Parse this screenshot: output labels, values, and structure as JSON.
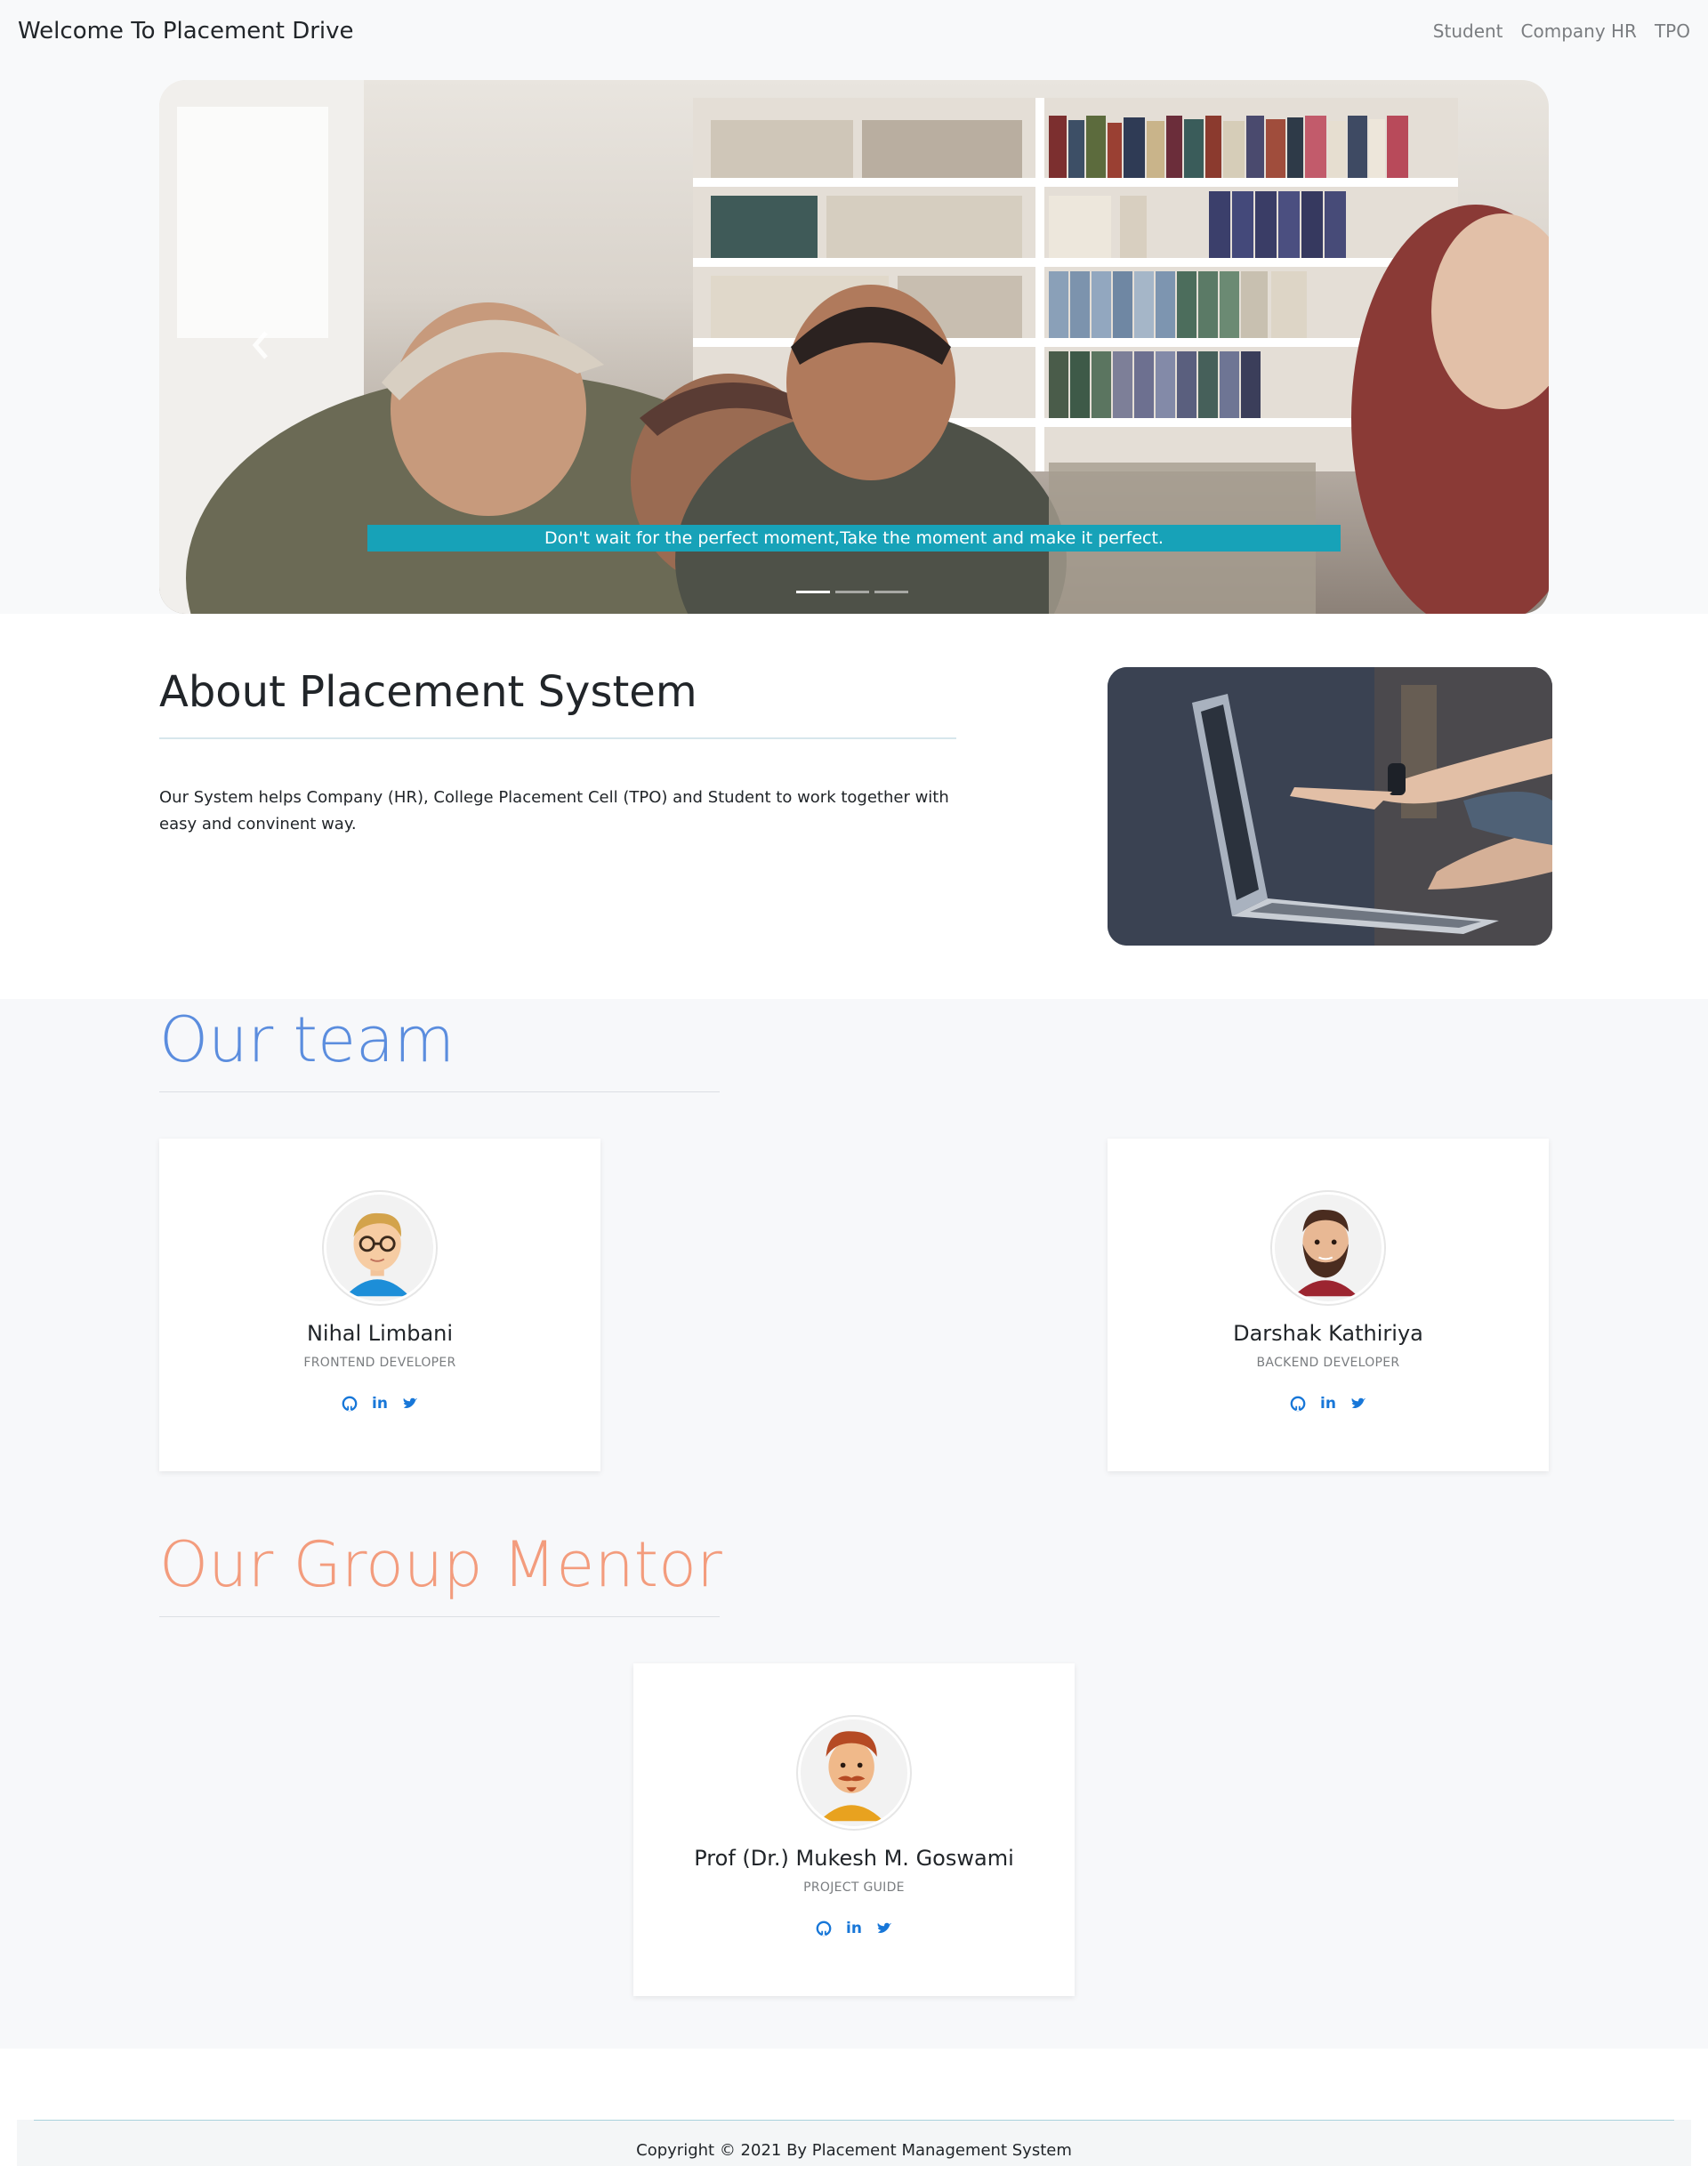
{
  "navbar": {
    "brand": "Welcome To Placement Drive",
    "links": [
      "Student",
      "Company HR",
      "TPO"
    ]
  },
  "carousel": {
    "caption": "Don't wait for the perfect moment,Take the moment and make it perfect.",
    "slide_count": 3,
    "active_slide": 1
  },
  "about": {
    "title": "About Placement System",
    "text": "Our System helps Company (HR), College Placement Cell (TPO) and Student to work together with easy and convinent way."
  },
  "team": {
    "title": "Our team",
    "members": [
      {
        "name": "Nihal Limbani",
        "role": "FRONTEND DEVELOPER"
      },
      {
        "name": "Darshak Kathiriya",
        "role": "BACKEND DEVELOPER"
      }
    ]
  },
  "mentor": {
    "title": "Our Group Mentor",
    "name": "Prof (Dr.) Mukesh M. Goswami",
    "role": "PROJECT GUIDE"
  },
  "social_icons": [
    "github-icon",
    "linkedin-icon",
    "twitter-icon"
  ],
  "footer": {
    "text": "Copyright © 2021 By Placement Management System"
  },
  "colors": {
    "caption_bg": "#17a2b8",
    "team_title": "#5b8dde",
    "mentor_title": "#f39c7d",
    "social": "#1877d8"
  }
}
